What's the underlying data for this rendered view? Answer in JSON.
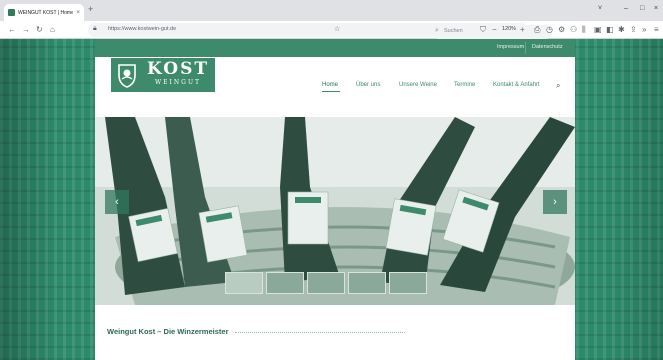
{
  "browser": {
    "tab_title": "WEINGUT KOST | Homeseite bei",
    "tab_close": "×",
    "new_tab": "+",
    "url": "https://www.kostwein-gut.de",
    "search_placeholder": "Suchen",
    "zoom": "120%",
    "window_controls": [
      "˅",
      "–",
      "□",
      "×"
    ],
    "colors": {
      "tab_bg": "#dfe1e5",
      "toolbar_bg": "#ffffff"
    }
  },
  "site": {
    "top_links": [
      "Impressum",
      "Datenschutz"
    ],
    "logo": {
      "name": "KOST",
      "sub": "WEINGUT"
    },
    "nav": [
      "Home",
      "Über uns",
      "Unsere Weine",
      "Termine",
      "Kontakt & Anfahrt"
    ],
    "nav_active": "Home",
    "slider": {
      "prev": "‹",
      "next": "›"
    },
    "intro_title": "Weingut Kost – Die Winzermeister",
    "colors": {
      "brand": "#3d8a6c",
      "brand_dark": "#2b6a51",
      "page_bg": "#2d8b6b"
    }
  }
}
